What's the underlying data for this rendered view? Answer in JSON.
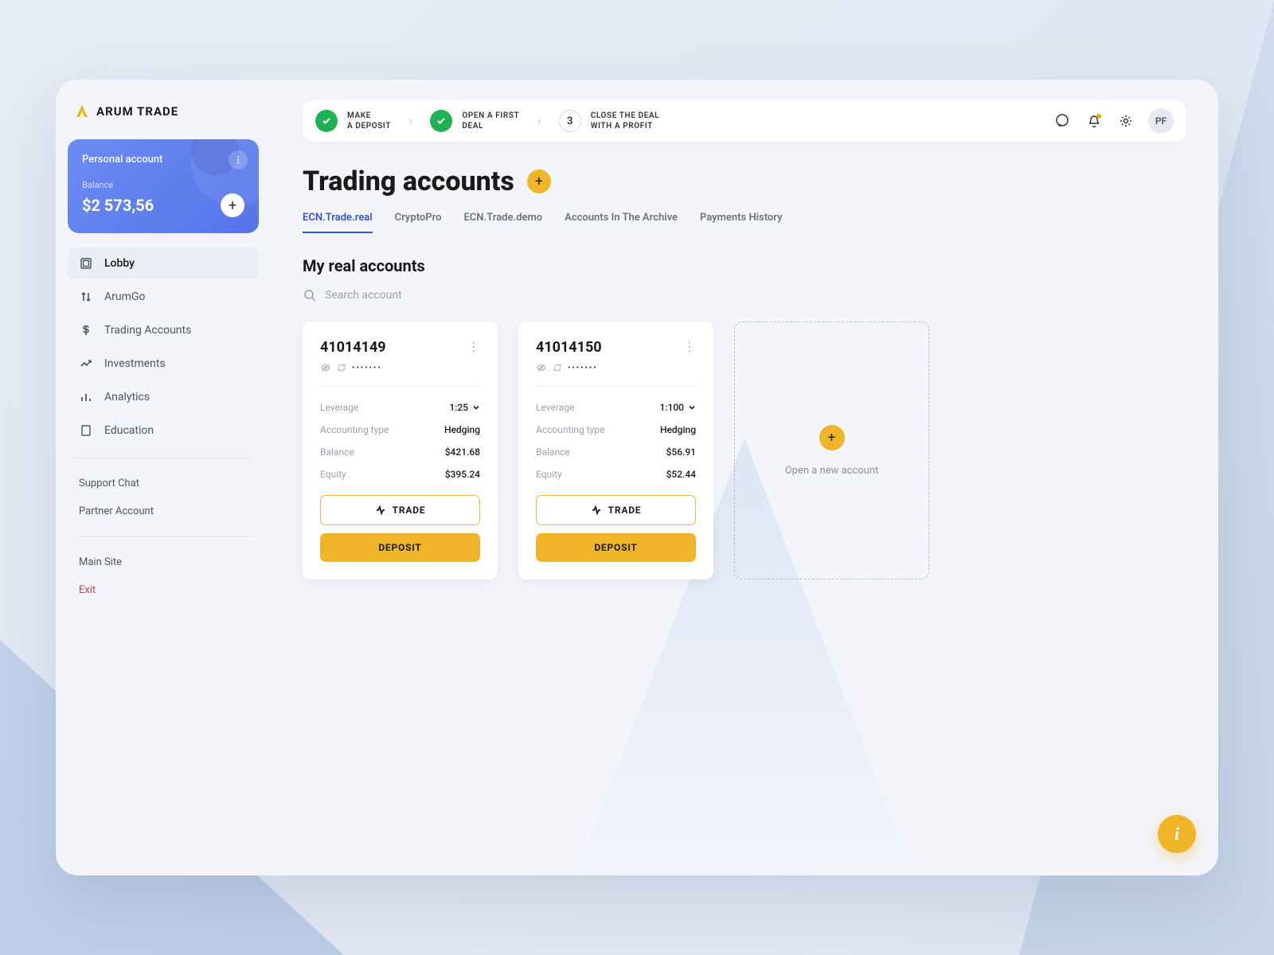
{
  "brand": "ARUM TRADE",
  "sidebar": {
    "card": {
      "title": "Personal account",
      "balance_label": "Balance",
      "balance": "$2 573,56"
    },
    "nav": [
      {
        "label": "Lobby"
      },
      {
        "label": "ArumGo"
      },
      {
        "label": "Trading Accounts"
      },
      {
        "label": "Investments"
      },
      {
        "label": "Analytics"
      },
      {
        "label": "Education"
      }
    ],
    "links": {
      "support": "Support Chat",
      "partner": "Partner Account",
      "main_site": "Main Site",
      "exit": "Exit"
    }
  },
  "steps": [
    {
      "line1": "MAKE",
      "line2": "A DEPOSIT",
      "status": "done"
    },
    {
      "line1": "OPEN A FIRST",
      "line2": "DEAL",
      "status": "done"
    },
    {
      "line1": "CLOSE THE DEAL",
      "line2": "WITH A PROFIT",
      "status": "3"
    }
  ],
  "user_initials": "PF",
  "page": {
    "title": "Trading accounts",
    "tabs": [
      "ECN.Trade.real",
      "CryptoPro",
      "ECN.Trade.demo",
      "Accounts In The Archive",
      "Payments History"
    ],
    "section": "My real accounts",
    "search_placeholder": "Search account"
  },
  "accounts": [
    {
      "number": "41014149",
      "masked": "•••••••",
      "leverage_label": "Leverage",
      "leverage": "1:25",
      "acct_type_label": "Accounting type",
      "acct_type": "Hedging",
      "balance_label": "Balance",
      "balance": "$421.68",
      "equity_label": "Equity",
      "equity": "$395.24",
      "trade_label": "TRADE",
      "deposit_label": "DEPOSIT"
    },
    {
      "number": "41014150",
      "masked": "•••••••",
      "leverage_label": "Leverage",
      "leverage": "1:100",
      "acct_type_label": "Accounting type",
      "acct_type": "Hedging",
      "balance_label": "Balance",
      "balance": "$56.91",
      "equity_label": "Equity",
      "equity": "$52.44",
      "trade_label": "TRADE",
      "deposit_label": "DEPOSIT"
    }
  ],
  "new_account_label": "Open a new account"
}
